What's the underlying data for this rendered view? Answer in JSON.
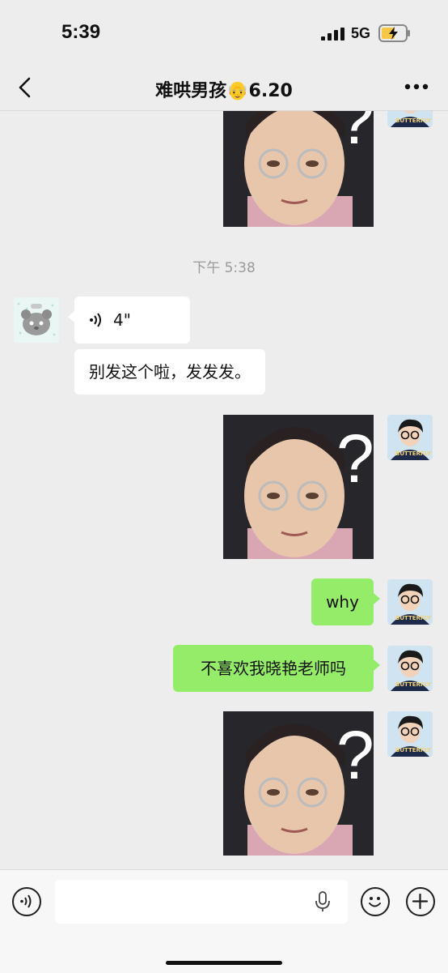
{
  "status_bar": {
    "time": "5:39",
    "network": "5G"
  },
  "nav": {
    "title": "难哄男孩👴6.20"
  },
  "messages": {
    "timestamp": "下午 5:38",
    "voice_duration": "4\"",
    "received_text": "别发这个啦，发发发。",
    "sent_why": "why",
    "sent_question": "不喜欢我晓艳老师吗"
  },
  "sticker": {
    "glyph": "?"
  },
  "avatar": {
    "shirt_text": "BUTTERFLY"
  },
  "colors": {
    "background": "#ededed",
    "sent_bubble": "#95ec69",
    "received_bubble": "#ffffff",
    "input_bar": "#f7f7f7"
  },
  "icons": [
    "signal-icon",
    "battery-charging-icon",
    "back-chevron-icon",
    "more-dots-icon",
    "voice-wave-icon",
    "voice-mode-icon",
    "microphone-icon",
    "emoji-icon",
    "plus-icon"
  ]
}
